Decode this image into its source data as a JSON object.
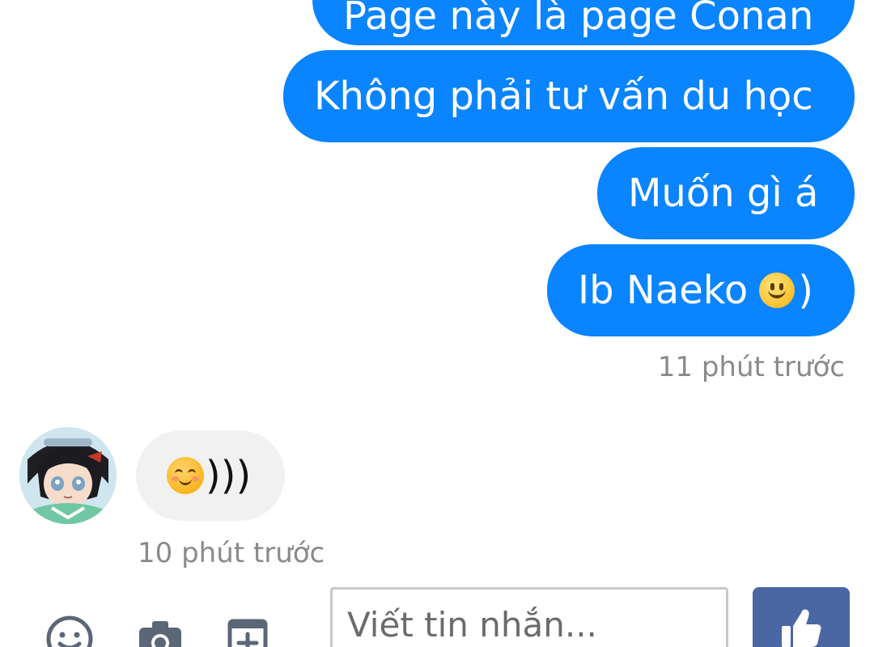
{
  "conversation": {
    "outgoing": [
      {
        "text": "Page này là page Conan"
      },
      {
        "text": "Không phải tư vấn du học"
      },
      {
        "text": "Muốn gì á"
      },
      {
        "text": "Ib Naeko",
        "emoji": "slight-smile-emoji",
        "suffix": ")"
      }
    ],
    "outgoing_time": "11 phút trước",
    "incoming": {
      "emoji": "smiling-face-with-smiling-eyes-emoji",
      "text": ")))",
      "time": "10 phút trước"
    }
  },
  "composer": {
    "placeholder": "Viết tin nhắn...",
    "icons": [
      "emoji-icon",
      "camera-icon",
      "attach-icon"
    ],
    "like_icon": "thumbs-up-icon"
  },
  "colors": {
    "outgoing_bubble": "#0a84ff",
    "incoming_bubble": "#f1f1f1",
    "like_button": "#4a67a4",
    "timestamp": "#8a8a8a"
  }
}
